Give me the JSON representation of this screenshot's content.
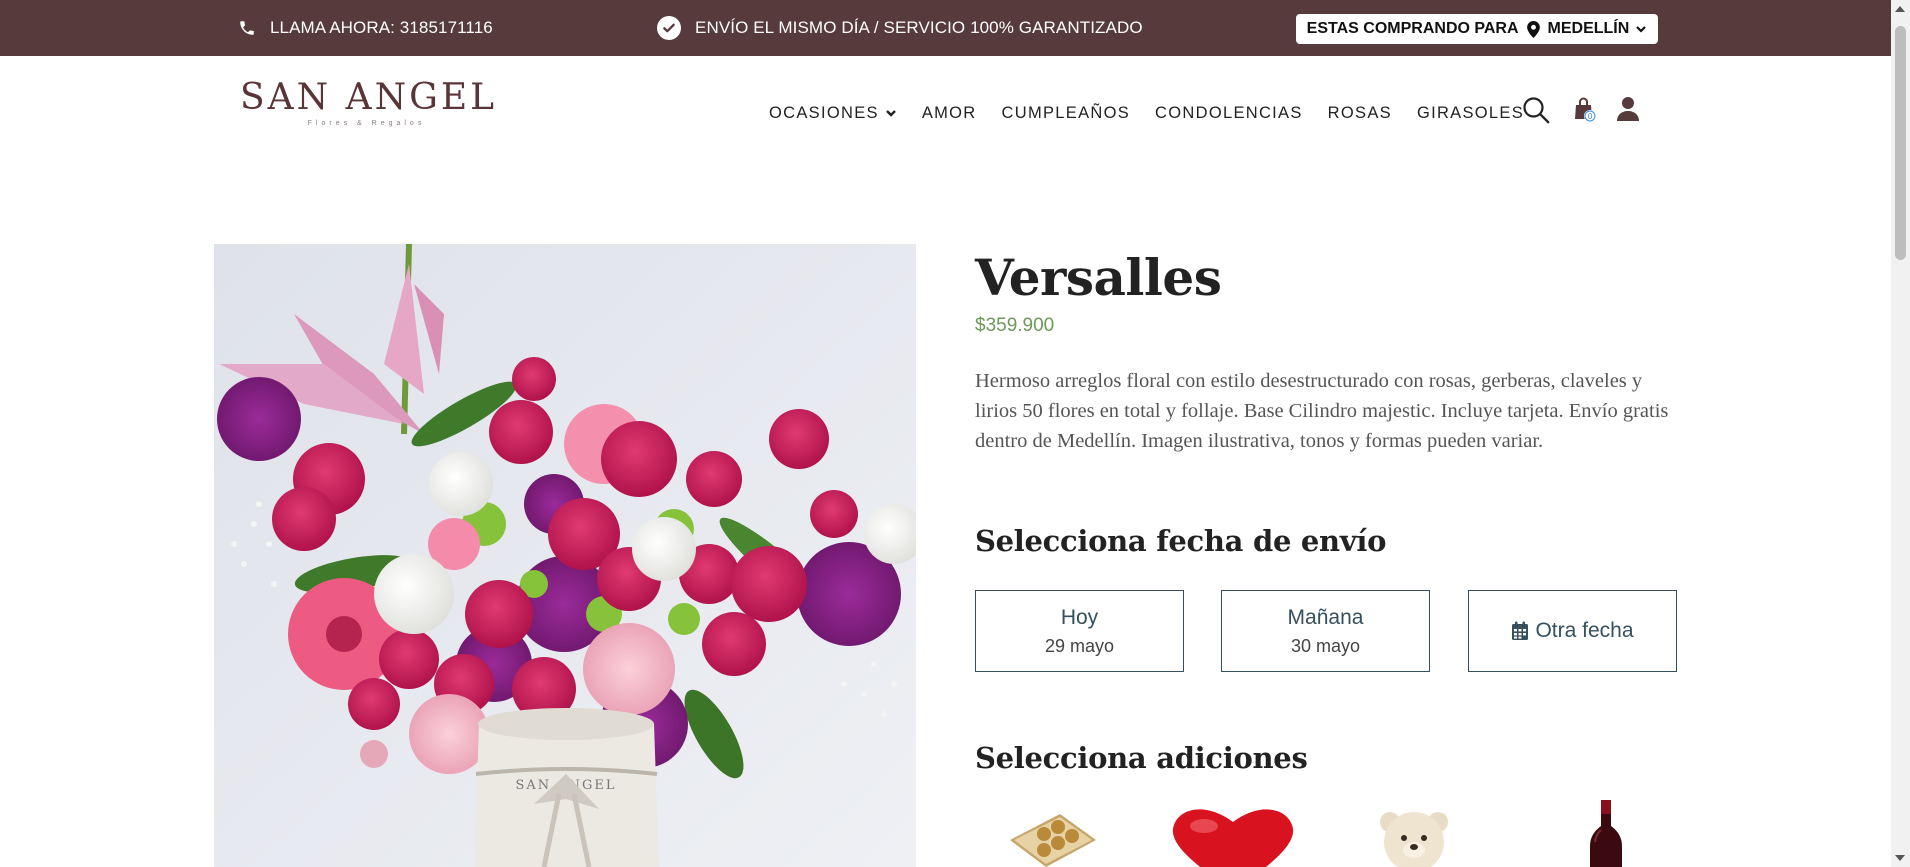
{
  "topbar": {
    "phone_text": "LLAMA AHORA: 3185171116",
    "shipping_text": "ENVÍO EL MISMO DÍA / SERVICIO 100% GARANTIZADO",
    "city_prefix": "ESTAS COMPRANDO PARA",
    "city_name": "MEDELLÍN",
    "bg_color": "#573a3c"
  },
  "header": {
    "logo_text": "SAN ANGEL",
    "logo_sub": "Flores & Regalos",
    "nav": [
      {
        "label": "OCASIONES",
        "has_dropdown": true
      },
      {
        "label": "AMOR"
      },
      {
        "label": "CUMPLEAÑOS"
      },
      {
        "label": "CONDOLENCIAS"
      },
      {
        "label": "ROSAS"
      },
      {
        "label": "GIRASOLES"
      }
    ],
    "cart_count": "0",
    "icons": [
      "search-icon",
      "shopping-bag-icon",
      "user-icon"
    ]
  },
  "product": {
    "title": "Versalles",
    "price": "$359.900",
    "price_color": "#6c9a5a",
    "description": "Hermoso arreglos floral con estilo desestructurado con rosas, gerberas, claveles y lirios 50 flores en total y follaje. Base Cilindro majestic. Incluye tarjeta. Envío gratis dentro de Medellín. Imagen ilustrativa, tonos y formas pueden variar.",
    "vase_text": "SAN ANGEL"
  },
  "delivery": {
    "title": "Selecciona fecha de envío",
    "options": [
      {
        "day": "Hoy",
        "date": "29 mayo"
      },
      {
        "day": "Mañana",
        "date": "30 mayo"
      },
      {
        "day": "Otra fecha"
      }
    ]
  },
  "addons": {
    "title": "Selecciona adiciones",
    "items": [
      "chocolates",
      "heart-balloon",
      "teddy-bear",
      "wine-bottle"
    ]
  }
}
